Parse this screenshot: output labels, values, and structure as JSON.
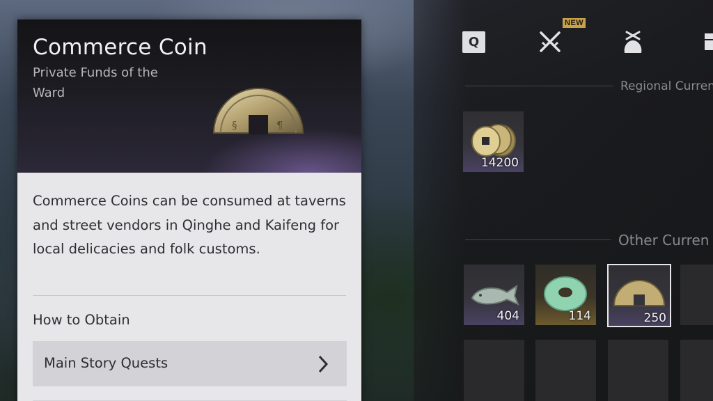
{
  "item": {
    "title": "Commerce Coin",
    "subtitle": "Private Funds of the Ward",
    "description": "Commerce Coins can be consumed at taverns and street vendors in Qinghe and Kaifeng for local delicacies and folk customs.",
    "how_to_obtain_label": "How to Obtain",
    "obtain_sources": [
      "Main Story Quests"
    ],
    "icon": "half-coin-icon"
  },
  "tabs": [
    {
      "label": "Q",
      "icon": "q-key-icon"
    },
    {
      "icon": "crossed-swords-icon",
      "badge": "NEW"
    },
    {
      "icon": "money-pouch-icon"
    },
    {
      "icon": "chest-icon"
    }
  ],
  "sections": {
    "regional": {
      "label": "Regional Curren",
      "items": [
        {
          "icon": "coin-stack-icon",
          "quantity": "14200",
          "rarity": "purple"
        }
      ]
    },
    "other": {
      "label": "Other Curren",
      "items": [
        {
          "icon": "fish-token-icon",
          "quantity": "404",
          "rarity": "purple"
        },
        {
          "icon": "jade-disc-icon",
          "quantity": "114",
          "rarity": "gold"
        },
        {
          "icon": "half-coin-icon",
          "quantity": "250",
          "rarity": "purple",
          "selected": true
        }
      ]
    }
  },
  "colors": {
    "card_bg": "#e7e6e9",
    "rarity_purple": "#4a4263",
    "rarity_gold": "#6e5a2e",
    "badge_new": "#c8a24a"
  }
}
